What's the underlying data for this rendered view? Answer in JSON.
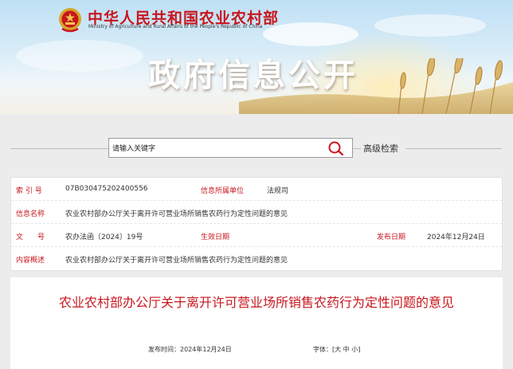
{
  "header": {
    "ministry_cn": "中华人民共和国农业农村部",
    "ministry_en": "Ministry of Agriculture and Rural Affairs of the People's Republic of China",
    "banner_title": "政府信息公开"
  },
  "search": {
    "placeholder": "请输入关键字",
    "advanced_label": "高级检索"
  },
  "info": {
    "index_label": "索 引 号",
    "index_value": "07B030475202400556",
    "org_label": "信息所属单位",
    "org_value": "法规司",
    "name_label": "信息名称",
    "name_value": "农业农村部办公厅关于离开许可营业场所销售农药行为定性问题的意见",
    "doc_label": "文　　号",
    "doc_value": "农办法函〔2024〕19号",
    "effect_label": "生效日期",
    "effect_value": "",
    "publish_label": "发布日期",
    "publish_value": "2024年12月24日",
    "summary_label": "内容概述",
    "summary_value": "农业农村部办公厅关于离开许可营业场所销售农药行为定性问题的意见"
  },
  "article": {
    "title": "农业农村部办公厅关于离开许可营业场所销售农药行为定性问题的意见",
    "publish_time": "发布时间：2024年12月24日",
    "font_label": "字体：",
    "font_sizes": [
      "大",
      "中",
      "小"
    ]
  },
  "colors": {
    "accent": "#c8161d"
  }
}
